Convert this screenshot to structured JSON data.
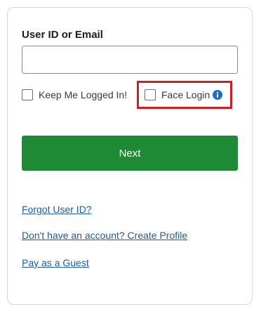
{
  "login_form": {
    "user_id_label": "User ID or Email",
    "user_id_value": "",
    "user_id_placeholder": "",
    "keep_logged_in_label": "Keep Me Logged In!",
    "keep_logged_in_checked": false,
    "face_login_label": "Face Login",
    "face_login_checked": false,
    "face_login_info_icon": "info-icon",
    "next_button_label": "Next"
  },
  "links": {
    "forgot_user_id": "Forgot User ID?",
    "create_profile": "Don't have an account? Create Profile",
    "pay_as_guest": "Pay as a Guest"
  },
  "colors": {
    "primary_button": "#1e8a36",
    "link": "#1f5b9e",
    "highlight": "#cc2027",
    "info_icon": "#1f6fc4"
  }
}
